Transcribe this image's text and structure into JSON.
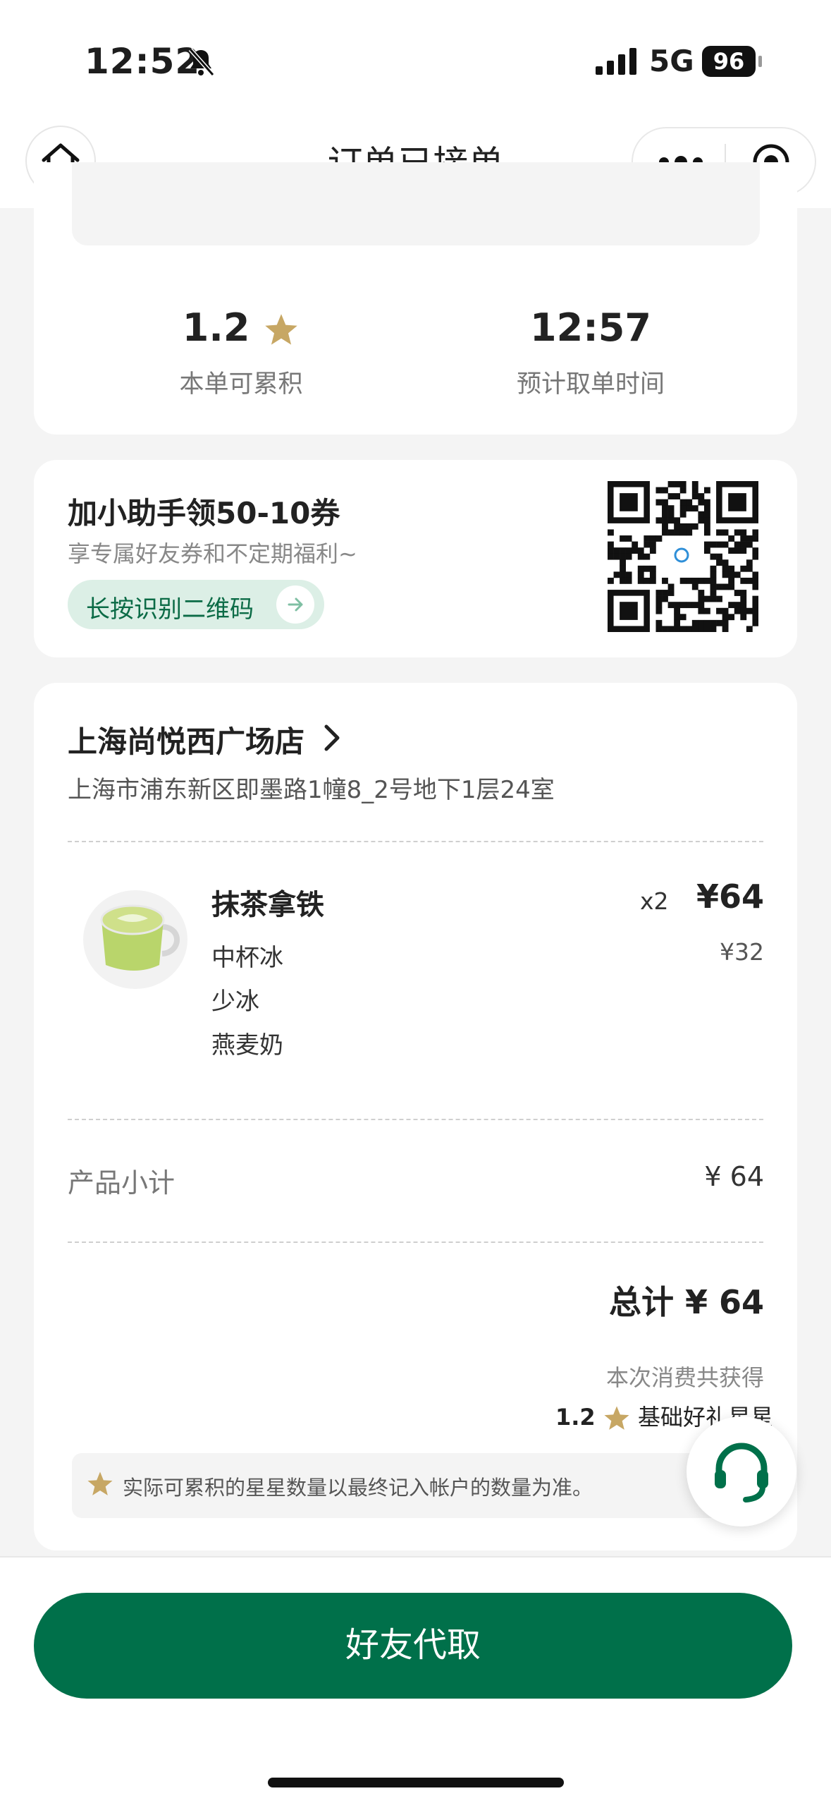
{
  "status_bar": {
    "time": "12:52",
    "network": "5G",
    "battery": "96"
  },
  "nav": {
    "title": "订单已接单",
    "home_icon": "home-icon",
    "more_icon": "more-dots-icon",
    "close_icon": "target-close-icon"
  },
  "summary": {
    "stars_value": "1.2",
    "stars_label": "本单可累积",
    "pickup_time": "12:57",
    "pickup_label": "预计取单时间"
  },
  "promo": {
    "title": "加小助手领50-10券",
    "subtitle": "享专属好友券和不定期福利~",
    "button_label": "长按识别二维码"
  },
  "store": {
    "name": "上海尚悦西广场店",
    "address": "上海市浦东新区即墨路1幢8_2号地下1层24室"
  },
  "items": [
    {
      "name": "抹茶拿铁",
      "options": [
        "中杯冰",
        "少冰",
        "燕麦奶"
      ],
      "quantity": "x2",
      "price": "¥64",
      "unit_price": "¥32"
    }
  ],
  "subtotal": {
    "label": "产品小计",
    "value": "¥ 64"
  },
  "total": {
    "label": "总计 ¥ 64"
  },
  "earn": {
    "label": "本次消费共获得",
    "value": "1.2",
    "suffix": "基础好礼星星"
  },
  "notice": "实际可累积的星星数量以最终记入帐户的数量为准。",
  "primary_button": "好友代取",
  "colors": {
    "brand_green": "#00704a",
    "star_gold": "#c7a764",
    "pill_bg": "#dcefe6"
  }
}
